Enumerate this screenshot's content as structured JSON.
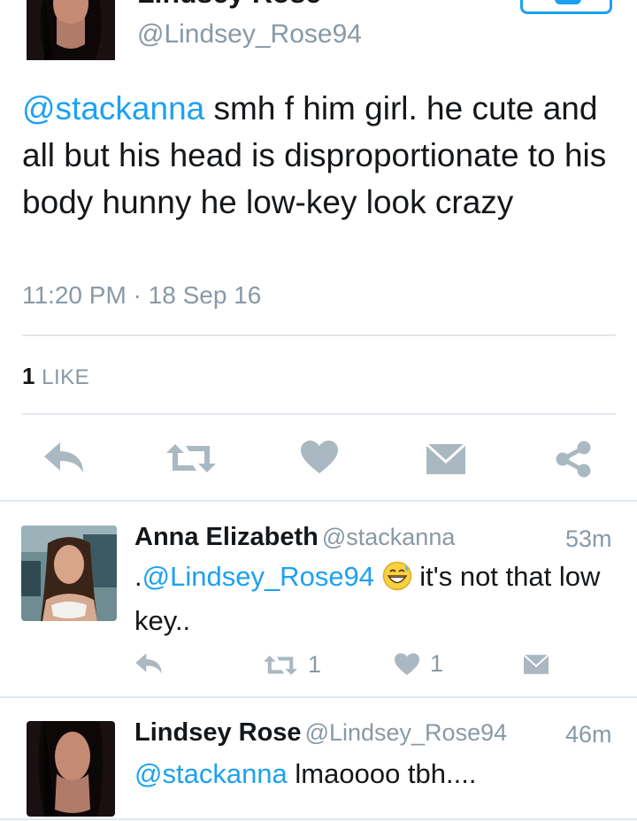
{
  "main_tweet": {
    "name": "Lindsey Rose",
    "handle": "@Lindsey_Rose94",
    "mention": "@stackanna",
    "text": " smh f him girl. he cute and all but his head is disproportionate to his body hunny he low-key look crazy",
    "timestamp": "11:20 PM · 18 Sep 16",
    "like_count": "1",
    "like_label": "LIKE"
  },
  "colors": {
    "accent": "#1da1f2",
    "secondary_text": "#8899a6",
    "icon_gray": "#aab8c2"
  },
  "replies": [
    {
      "name": "Anna Elizabeth",
      "handle": "@stackanna",
      "time": "53m",
      "prefix": ".",
      "mention": "@Lindsey_Rose94",
      "emoji": "grinning-sweat-face",
      "text_after": "it's not that low key..",
      "retweet_count": "1",
      "like_count": "1"
    },
    {
      "name": "Lindsey Rose",
      "handle": "@Lindsey_Rose94",
      "time": "46m",
      "mention": "@stackanna",
      "text_after": " lmaoooo tbh...."
    }
  ]
}
